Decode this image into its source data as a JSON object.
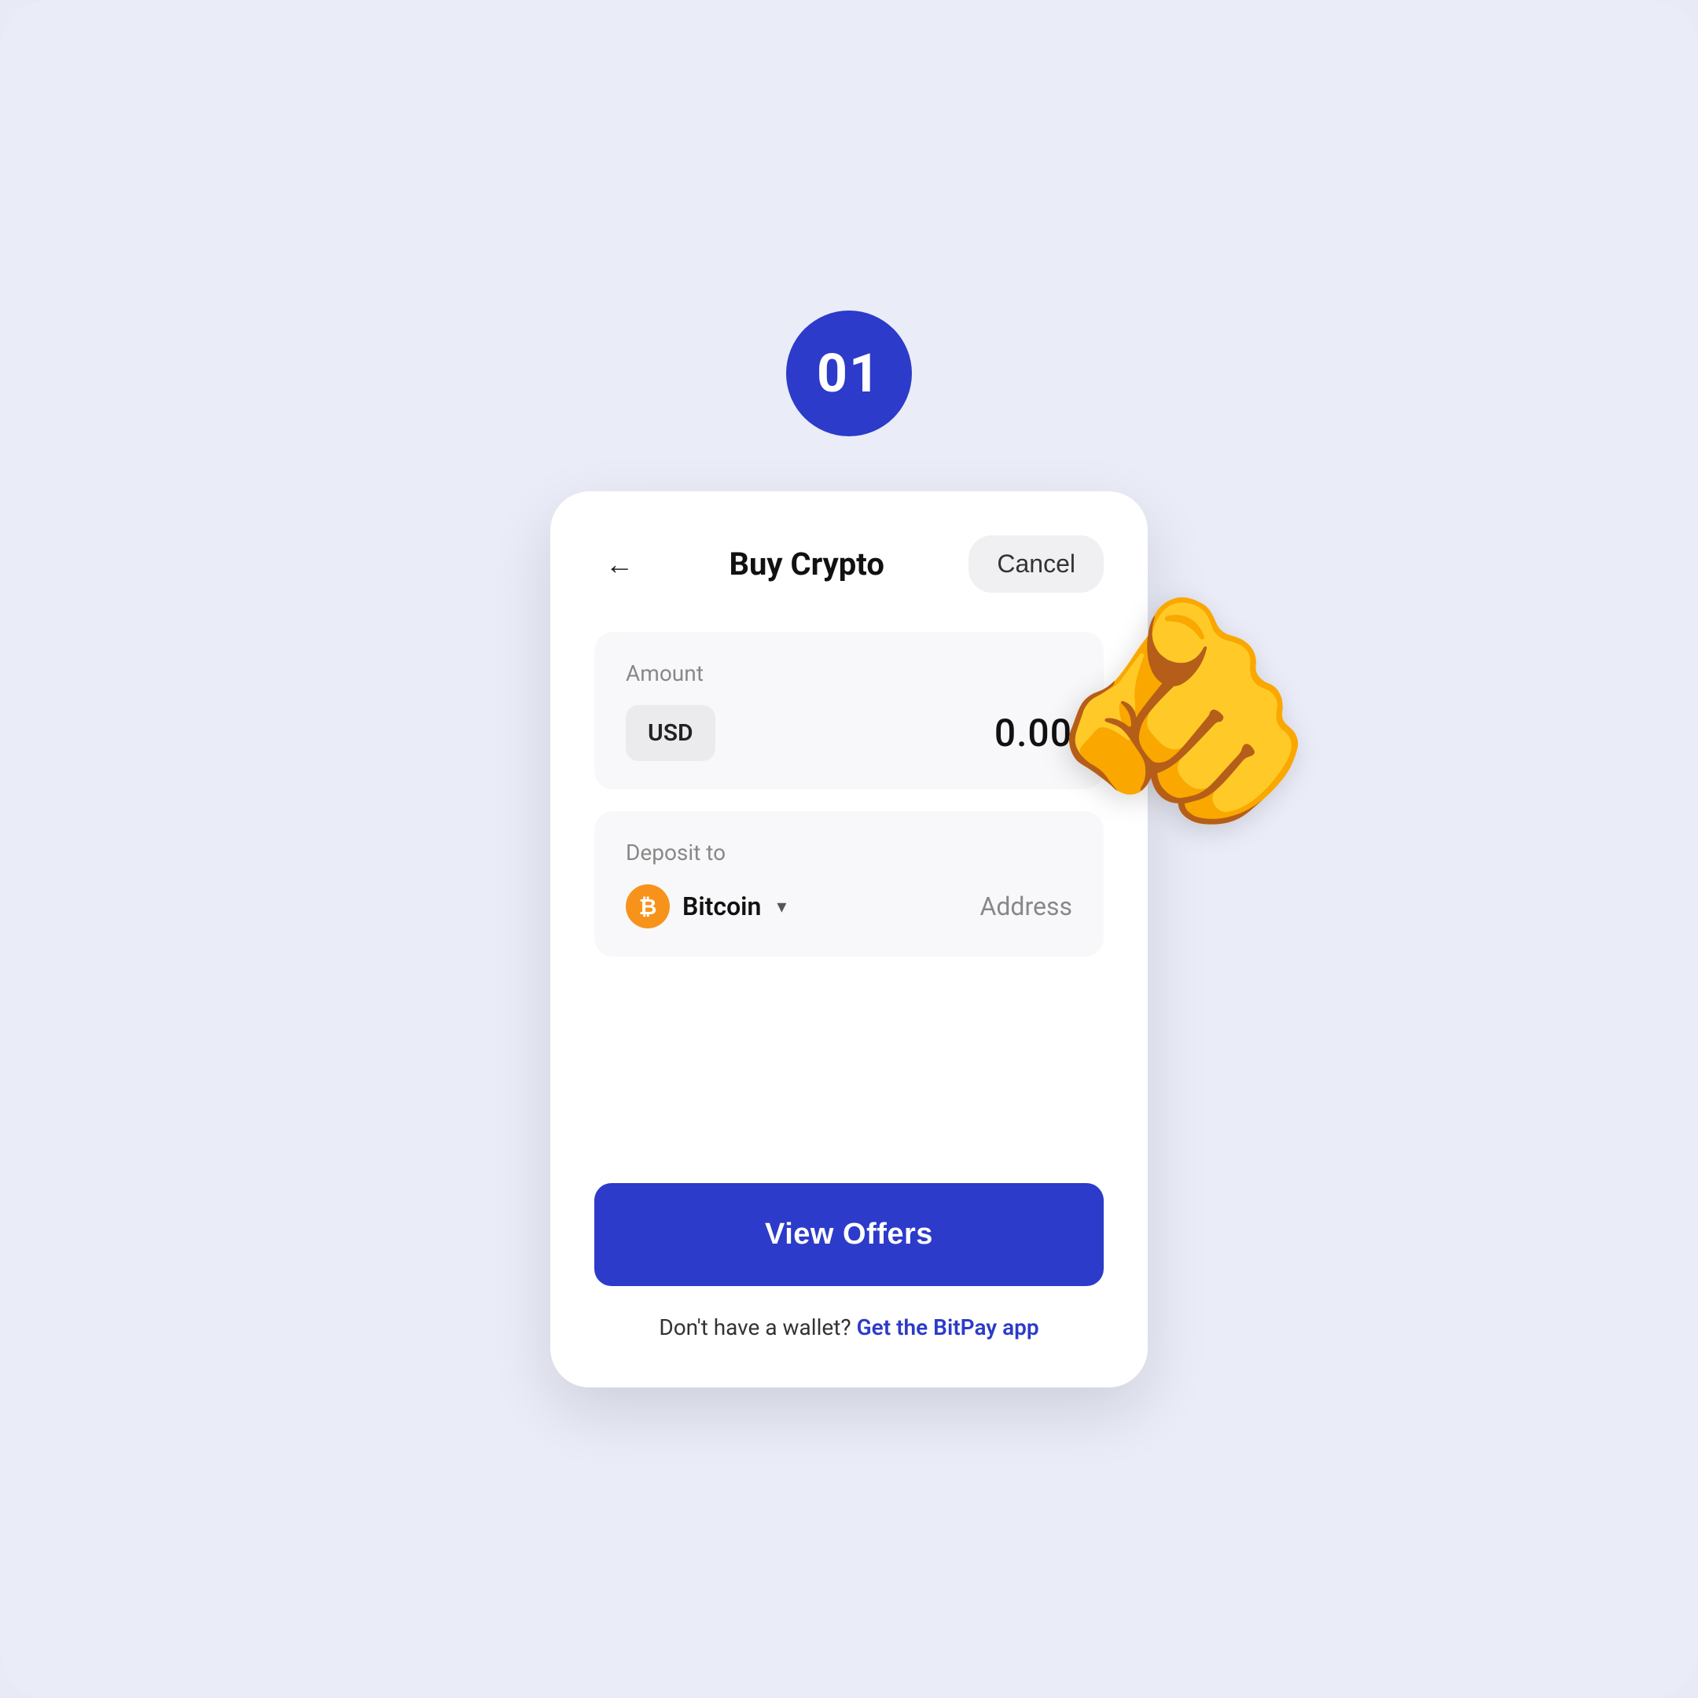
{
  "step": {
    "badge_number": "01"
  },
  "header": {
    "title": "Buy Crypto",
    "cancel_label": "Cancel",
    "back_icon": "←"
  },
  "amount_section": {
    "label": "Amount",
    "currency": "USD",
    "value": "0.00"
  },
  "deposit_section": {
    "label": "Deposit to",
    "crypto_name": "Bitcoin",
    "address_label": "Address"
  },
  "actions": {
    "view_offers_label": "View Offers"
  },
  "footer": {
    "no_wallet_text": "Don't have a wallet?",
    "link_text": "Get the BitPay app"
  },
  "colors": {
    "primary_blue": "#2c3bc9",
    "bitcoin_orange": "#f7931a",
    "background": "#eaecf8",
    "card_bg": "#f8f8fa"
  }
}
